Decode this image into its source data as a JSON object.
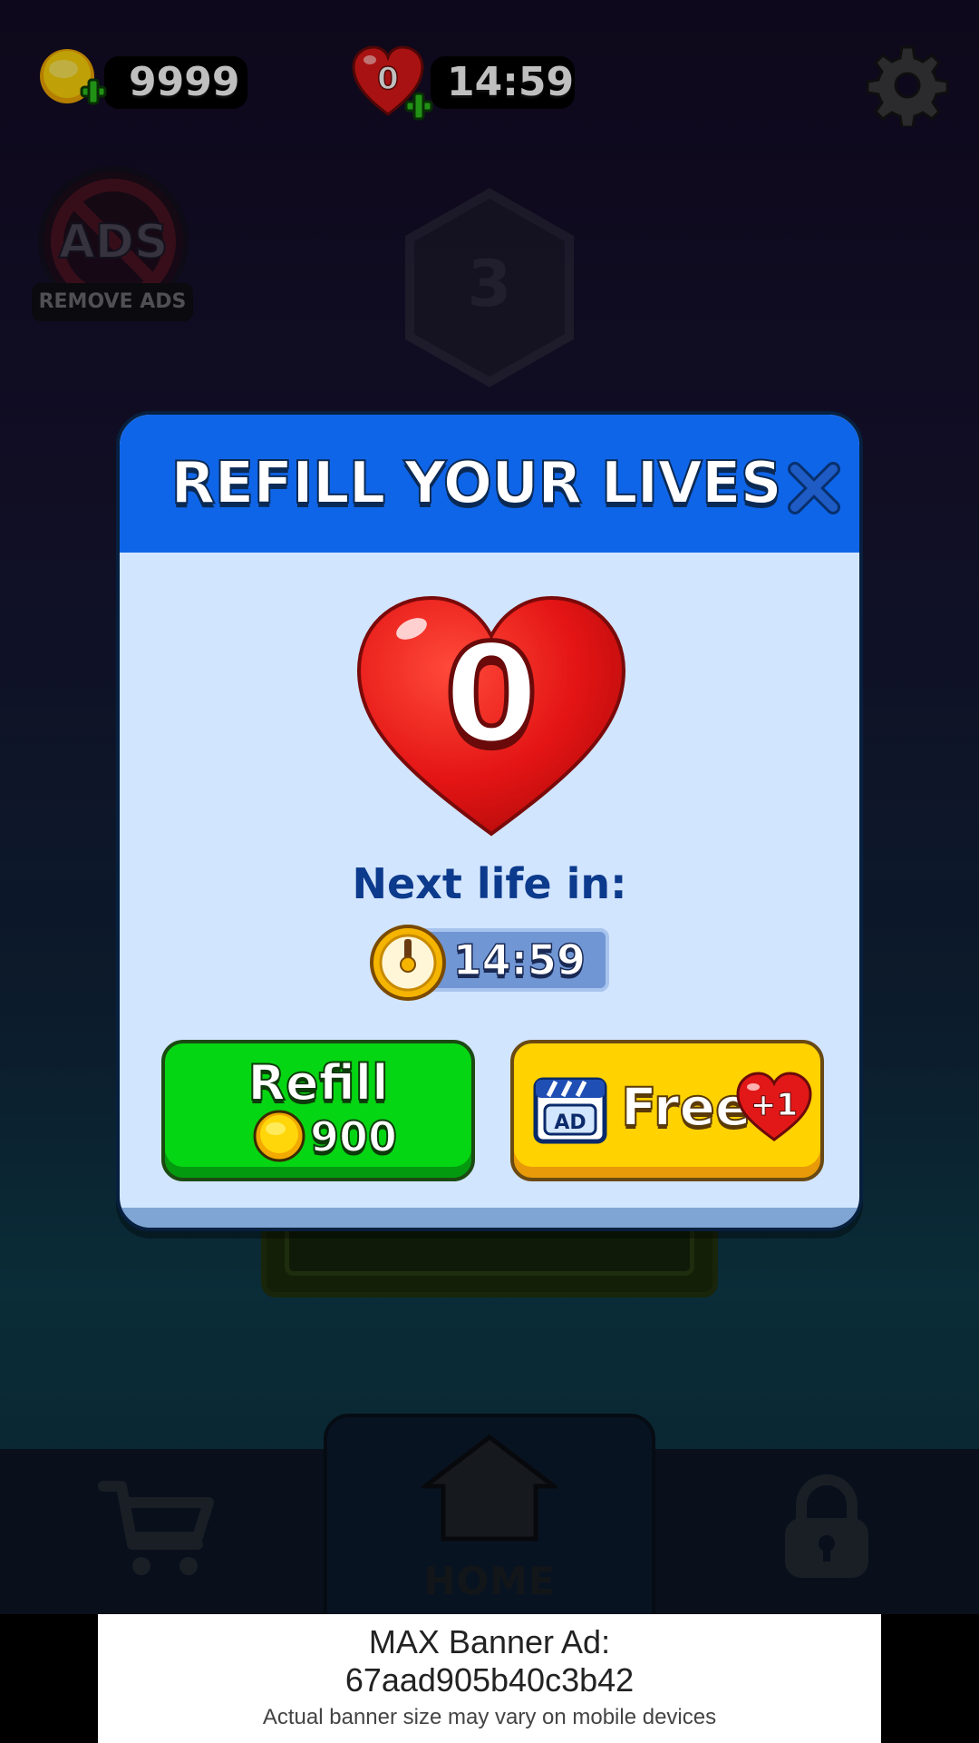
{
  "hud": {
    "coins": "9999",
    "lives_count": "0",
    "lives_timer": "14:59"
  },
  "background": {
    "remove_ads_badge": "ADS",
    "remove_ads_label": "REMOVE ADS",
    "level_number": "3"
  },
  "modal": {
    "title": "REFILL YOUR LIVES",
    "lives_count": "0",
    "next_life_label": "Next life in:",
    "next_life_timer": "14:59",
    "refill_button": {
      "label": "Refill",
      "price": "900"
    },
    "free_button": {
      "ad_label": "AD",
      "label": "Free",
      "bonus": "+1"
    }
  },
  "nav": {
    "home_label": "HOME"
  },
  "ad_banner": {
    "title_line1": "MAX Banner Ad:",
    "title_line2": "67aad905b40c3b42",
    "subtitle": "Actual banner size may vary on mobile devices"
  },
  "colors": {
    "modal_header": "#0f65e8",
    "modal_body": "#d2e5fe",
    "refill_green": "#05d613",
    "free_yellow": "#ffd200"
  }
}
